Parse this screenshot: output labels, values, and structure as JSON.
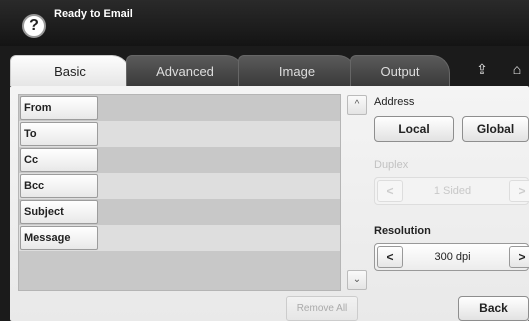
{
  "header": {
    "title": "Ready to Email",
    "help_icon": "?"
  },
  "tabs": [
    {
      "label": "Basic",
      "active": true
    },
    {
      "label": "Advanced",
      "active": false
    },
    {
      "label": "Image",
      "active": false
    },
    {
      "label": "Output",
      "active": false
    }
  ],
  "tab_icons": {
    "job_icon": "⇪",
    "home_icon": "⌂"
  },
  "fields": [
    {
      "label": "From"
    },
    {
      "label": "To"
    },
    {
      "label": "Cc"
    },
    {
      "label": "Bcc"
    },
    {
      "label": "Subject"
    },
    {
      "label": "Message"
    }
  ],
  "scroll": {
    "up": "^",
    "down": "⌄"
  },
  "remove_all_label": "Remove All",
  "address": {
    "label": "Address",
    "local_label": "Local",
    "global_label": "Global"
  },
  "duplex": {
    "label": "Duplex",
    "value": "1 Sided",
    "prev": "<",
    "next": ">"
  },
  "resolution": {
    "label": "Resolution",
    "value": "300 dpi",
    "prev": "<",
    "next": ">"
  },
  "back_label": "Back"
}
